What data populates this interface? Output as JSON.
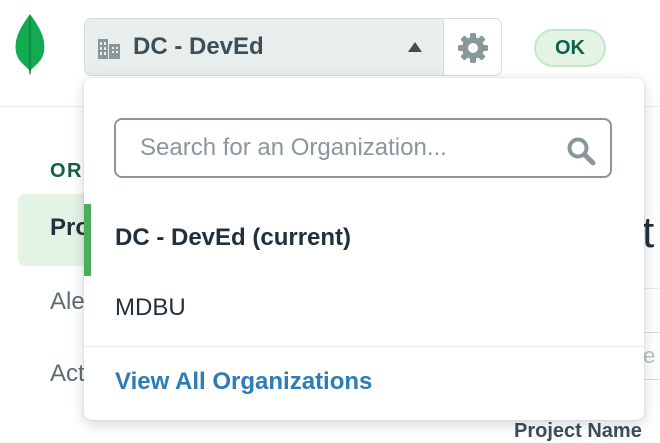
{
  "header": {
    "org_switcher": {
      "selected_org": "DC - DevEd",
      "org_icon": "building-icon",
      "caret_icon": "caret-up-icon"
    },
    "settings_icon": "gear-icon",
    "status_badge": "OK"
  },
  "sidebar": {
    "section_heading": "OR",
    "items": [
      {
        "label": "Pro",
        "active": true
      },
      {
        "label": "Ale",
        "active": false
      },
      {
        "label": "Act",
        "active": false
      }
    ]
  },
  "main": {
    "heading_fragment": "ct",
    "input_fragment": "e",
    "column_header_fragment": "Project Name"
  },
  "org_dropdown": {
    "search": {
      "placeholder": "Search for an Organization...",
      "value": "",
      "icon": "search-icon"
    },
    "orgs": [
      {
        "label": "DC - DevEd (current)",
        "current": true
      },
      {
        "label": "MDBU",
        "current": false
      }
    ],
    "view_all_label": "View All Organizations"
  },
  "colors": {
    "brand_green": "#13aa52",
    "link_blue": "#2d7cb5",
    "current_indicator": "#4ead5b",
    "badge_text": "#116149"
  }
}
